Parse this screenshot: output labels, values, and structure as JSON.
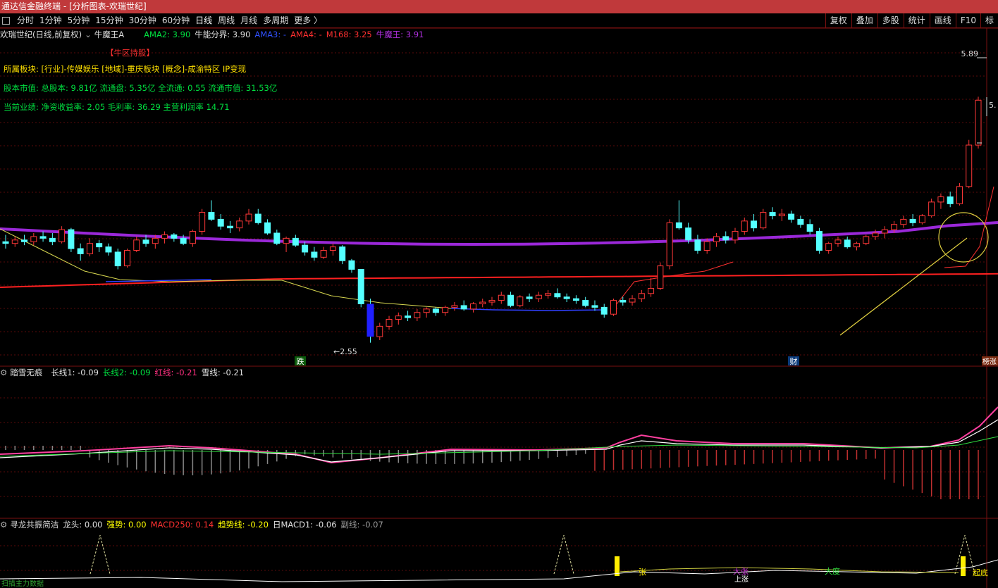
{
  "window": {
    "title": "通达信金融终端 - [分析图表-欢瑞世纪]"
  },
  "toolbar": {
    "periods": [
      "分时",
      "1分钟",
      "5分钟",
      "15分钟",
      "30分钟",
      "60分钟",
      "日线",
      "周线",
      "月线",
      "多周期",
      "更多 〉"
    ],
    "active_period": "日线",
    "right_buttons": [
      "复权",
      "叠加",
      "多股",
      "统计",
      "画线",
      "F10",
      "标"
    ]
  },
  "main_legend": {
    "stock": "欢瑞世纪(日线,前复权)",
    "indicator": "牛魔王A",
    "items": [
      {
        "text": "AMA2: 3.90",
        "color": "#00e040"
      },
      {
        "text": "牛能分界: 3.90",
        "color": "#e0e0e0"
      },
      {
        "text": "AMA3: -",
        "color": "#3050ff"
      },
      {
        "text": "AMA4: -",
        "color": "#ff3030"
      },
      {
        "text": "M168: 3.25",
        "color": "#ff3030"
      },
      {
        "text": "牛魔王: 3.91",
        "color": "#b030e0"
      }
    ]
  },
  "info": {
    "tag": "【牛区持股】",
    "sector": "所属板块: [行业]-传媒娱乐 [地域]-重庆板块 [概念]-成渝特区 IP变现",
    "capital": "股本市值: 总股本: 9.81亿 流通盘: 5.35亿 全流通: 0.55 流通市值: 31.53亿",
    "performance": "当前业绩:  净资收益率: 2.05 毛利率: 36.29 主营利润率 14.71"
  },
  "price_labels": {
    "high": "5.89",
    "right_cut": "5.",
    "low": "2.55"
  },
  "markers": {
    "fall": "跌",
    "finance": "财",
    "list": "榜涨"
  },
  "pane2_legend": {
    "name": "踏雪无痕",
    "items": [
      {
        "text": "长线1: -0.09",
        "color": "#e0e0e0"
      },
      {
        "text": "长线2: -0.09",
        "color": "#00e040"
      },
      {
        "text": "红线: -0.21",
        "color": "#ff3080"
      },
      {
        "text": "雪线: -0.21",
        "color": "#e0e0e0"
      }
    ]
  },
  "pane3_legend": {
    "name": "寻龙共振简洁",
    "items": [
      {
        "text": "龙头: 0.00",
        "color": "#e0e0e0"
      },
      {
        "text": "强势: 0.00",
        "color": "#ffff00"
      },
      {
        "text": "MACD250: 0.14",
        "color": "#ff3030"
      },
      {
        "text": "趋势线: -0.20",
        "color": "#ffff00"
      },
      {
        "text": "日MACD1: -0.06",
        "color": "#e0e0e0"
      },
      {
        "text": "副线: -0.07",
        "color": "#999999"
      }
    ]
  },
  "pane3_labels": {
    "zhang": "张",
    "dazhang": "大张",
    "dadu": "大度",
    "shangzhang": "上涨",
    "qidi": "起底",
    "footer": "扫描主力数据"
  },
  "chart_data": {
    "type": "candlestick",
    "x": "trading days (unlabeled)",
    "ohlc": [
      [
        3.72,
        3.8,
        3.64,
        3.7
      ],
      [
        3.7,
        3.78,
        3.66,
        3.74
      ],
      [
        3.74,
        3.8,
        3.68,
        3.72
      ],
      [
        3.72,
        3.82,
        3.68,
        3.78
      ],
      [
        3.78,
        3.84,
        3.72,
        3.76
      ],
      [
        3.76,
        3.82,
        3.68,
        3.72
      ],
      [
        3.72,
        3.9,
        3.7,
        3.86
      ],
      [
        3.86,
        3.88,
        3.6,
        3.64
      ],
      [
        3.64,
        3.7,
        3.5,
        3.58
      ],
      [
        3.58,
        3.76,
        3.55,
        3.7
      ],
      [
        3.7,
        3.74,
        3.6,
        3.66
      ],
      [
        3.66,
        3.7,
        3.56,
        3.6
      ],
      [
        3.6,
        3.64,
        3.4,
        3.44
      ],
      [
        3.44,
        3.64,
        3.42,
        3.62
      ],
      [
        3.62,
        3.78,
        3.6,
        3.74
      ],
      [
        3.74,
        3.8,
        3.66,
        3.7
      ],
      [
        3.7,
        3.8,
        3.64,
        3.76
      ],
      [
        3.76,
        3.84,
        3.7,
        3.8
      ],
      [
        3.8,
        3.82,
        3.72,
        3.76
      ],
      [
        3.76,
        3.8,
        3.68,
        3.7
      ],
      [
        3.7,
        3.86,
        3.66,
        3.84
      ],
      [
        3.84,
        4.1,
        3.8,
        4.06
      ],
      [
        4.06,
        4.2,
        3.96,
        3.98
      ],
      [
        3.98,
        4.04,
        3.86,
        3.9
      ],
      [
        3.9,
        3.96,
        3.82,
        3.88
      ],
      [
        3.88,
        4.0,
        3.84,
        3.96
      ],
      [
        3.96,
        4.1,
        3.92,
        4.04
      ],
      [
        4.04,
        4.1,
        3.92,
        3.94
      ],
      [
        3.94,
        3.98,
        3.8,
        3.82
      ],
      [
        3.82,
        3.86,
        3.68,
        3.7
      ],
      [
        3.7,
        3.78,
        3.6,
        3.76
      ],
      [
        3.76,
        3.8,
        3.66,
        3.68
      ],
      [
        3.68,
        3.72,
        3.56,
        3.6
      ],
      [
        3.6,
        3.66,
        3.5,
        3.54
      ],
      [
        3.54,
        3.66,
        3.52,
        3.62
      ],
      [
        3.62,
        3.7,
        3.56,
        3.66
      ],
      [
        3.66,
        3.68,
        3.46,
        3.5
      ],
      [
        3.5,
        3.52,
        3.36,
        3.4
      ],
      [
        3.4,
        3.4,
        2.96,
        3.0
      ],
      [
        3.0,
        3.06,
        2.55,
        2.62
      ],
      [
        2.62,
        2.78,
        2.58,
        2.74
      ],
      [
        2.74,
        2.86,
        2.7,
        2.82
      ],
      [
        2.82,
        2.9,
        2.76,
        2.86
      ],
      [
        2.86,
        2.92,
        2.8,
        2.84
      ],
      [
        2.84,
        2.94,
        2.8,
        2.9
      ],
      [
        2.9,
        2.96,
        2.84,
        2.94
      ],
      [
        2.94,
        2.96,
        2.86,
        2.9
      ],
      [
        2.9,
        2.98,
        2.86,
        2.96
      ],
      [
        2.96,
        3.02,
        2.92,
        2.98
      ],
      [
        2.98,
        3.04,
        2.92,
        2.94
      ],
      [
        2.94,
        3.02,
        2.9,
        3.0
      ],
      [
        3.0,
        3.06,
        2.96,
        3.02
      ],
      [
        3.02,
        3.08,
        2.98,
        3.04
      ],
      [
        3.04,
        3.14,
        3.0,
        3.1
      ],
      [
        3.1,
        3.14,
        2.96,
        2.98
      ],
      [
        2.98,
        3.1,
        2.96,
        3.08
      ],
      [
        3.08,
        3.12,
        3.02,
        3.06
      ],
      [
        3.06,
        3.14,
        3.02,
        3.1
      ],
      [
        3.1,
        3.16,
        3.06,
        3.12
      ],
      [
        3.12,
        3.18,
        3.06,
        3.08
      ],
      [
        3.08,
        3.12,
        3.02,
        3.06
      ],
      [
        3.06,
        3.1,
        3.0,
        3.04
      ],
      [
        3.04,
        3.08,
        2.96,
        2.98
      ],
      [
        2.98,
        3.04,
        2.92,
        2.96
      ],
      [
        2.96,
        3.0,
        2.84,
        2.88
      ],
      [
        2.88,
        3.06,
        2.86,
        3.04
      ],
      [
        3.04,
        3.08,
        2.98,
        3.02
      ],
      [
        3.02,
        3.1,
        2.98,
        3.06
      ],
      [
        3.06,
        3.16,
        3.02,
        3.12
      ],
      [
        3.12,
        3.3,
        3.08,
        3.18
      ],
      [
        3.18,
        3.48,
        3.16,
        3.44
      ],
      [
        3.44,
        3.98,
        3.4,
        3.94
      ],
      [
        3.94,
        4.2,
        3.86,
        3.88
      ],
      [
        3.88,
        3.94,
        3.7,
        3.74
      ],
      [
        3.74,
        3.8,
        3.58,
        3.62
      ],
      [
        3.62,
        3.76,
        3.58,
        3.72
      ],
      [
        3.72,
        3.82,
        3.66,
        3.78
      ],
      [
        3.78,
        3.84,
        3.7,
        3.74
      ],
      [
        3.74,
        3.88,
        3.7,
        3.84
      ],
      [
        3.84,
        4.0,
        3.8,
        3.96
      ],
      [
        3.96,
        4.04,
        3.84,
        3.88
      ],
      [
        3.88,
        4.1,
        3.86,
        4.06
      ],
      [
        4.06,
        4.12,
        3.98,
        4.02
      ],
      [
        4.02,
        4.1,
        3.96,
        4.04
      ],
      [
        4.04,
        4.08,
        3.94,
        3.98
      ],
      [
        3.98,
        4.02,
        3.88,
        3.92
      ],
      [
        3.92,
        3.98,
        3.8,
        3.84
      ],
      [
        3.84,
        3.88,
        3.58,
        3.62
      ],
      [
        3.62,
        3.72,
        3.58,
        3.7
      ],
      [
        3.7,
        3.78,
        3.66,
        3.74
      ],
      [
        3.74,
        3.78,
        3.64,
        3.66
      ],
      [
        3.66,
        3.72,
        3.62,
        3.7
      ],
      [
        3.7,
        3.8,
        3.68,
        3.78
      ],
      [
        3.78,
        3.86,
        3.74,
        3.82
      ],
      [
        3.82,
        3.9,
        3.76,
        3.86
      ],
      [
        3.86,
        3.96,
        3.82,
        3.92
      ],
      [
        3.92,
        4.02,
        3.88,
        3.98
      ],
      [
        3.98,
        4.04,
        3.9,
        3.94
      ],
      [
        3.94,
        4.04,
        3.92,
        4.02
      ],
      [
        4.02,
        4.22,
        4.0,
        4.18
      ],
      [
        4.18,
        4.28,
        4.1,
        4.24
      ],
      [
        4.24,
        4.3,
        4.12,
        4.16
      ],
      [
        4.16,
        4.4,
        4.14,
        4.36
      ],
      [
        4.36,
        4.9,
        4.34,
        4.84
      ],
      [
        4.84,
        5.4,
        4.8,
        5.36
      ]
    ],
    "lines": [
      {
        "name": "M168",
        "color": "#ff2020"
      },
      {
        "name": "牛魔王",
        "color": "#9a28d8"
      }
    ]
  }
}
